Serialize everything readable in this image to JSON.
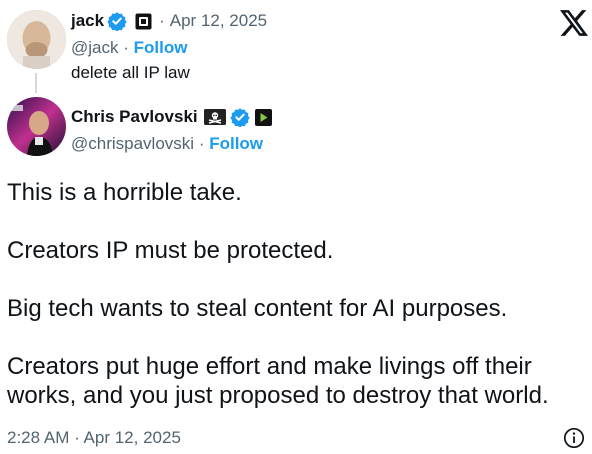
{
  "quoted": {
    "name": "jack",
    "date": "Apr 12, 2025",
    "date_sep": "·",
    "handle": "@jack",
    "handle_sep": "·",
    "follow": "Follow",
    "text": "delete all IP law"
  },
  "author": {
    "name": "Chris Pavlovski",
    "handle": "@chrispavlovski",
    "handle_sep": "·",
    "follow": "Follow"
  },
  "body": {
    "p1": "This is a horrible take.",
    "p2": "Creators IP must be protected.",
    "p3": "Big tech wants to steal content for AI purposes.",
    "p4": "Creators put huge effort and make livings off their works, and you just proposed to destroy that world."
  },
  "footer": {
    "timestamp": "2:28 AM · Apr 12, 2025"
  },
  "icons": {
    "x_logo": "x-logo-icon",
    "verified": "verified-badge-icon",
    "affiliate": "affiliate-square-icon",
    "pirate": "pirate-flag-icon",
    "rumble": "rumble-play-icon",
    "info": "info-icon"
  },
  "colors": {
    "verified": "#1d9bf0",
    "follow": "#1d9bf0",
    "muted": "#536471",
    "rumble": "#85c742"
  }
}
